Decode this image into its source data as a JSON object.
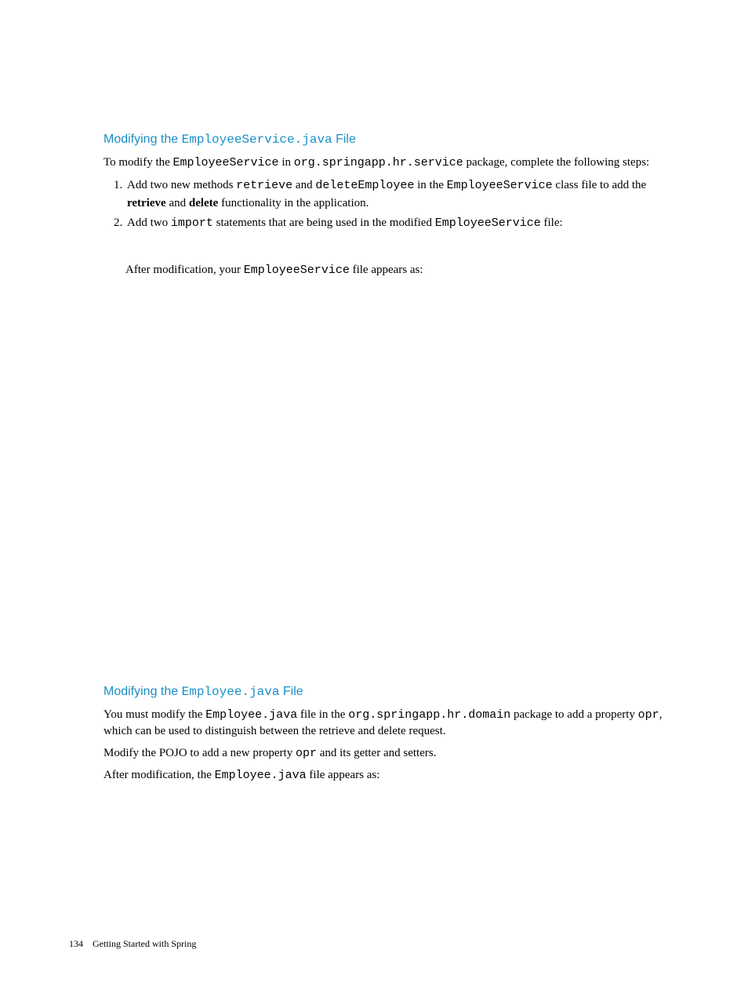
{
  "section1": {
    "heading_prefix": "Modifying the ",
    "heading_code": "EmployeeService.java",
    "heading_suffix": " File",
    "intro_p1": "To modify the ",
    "intro_code1": "EmployeeService",
    "intro_p2": " in ",
    "intro_code2": "org.springapp.hr.service",
    "intro_p3": " package, complete the following steps:",
    "step1_a": "Add two new methods ",
    "step1_code1": "retrieve",
    "step1_b": " and ",
    "step1_code2": "deleteEmployee",
    "step1_c": " in the ",
    "step1_code3": "EmployeeService",
    "step1_d": " class file to add the ",
    "step1_bold1": "retrieve",
    "step1_e": " and ",
    "step1_bold2": "delete",
    "step1_f": " functionality in the application.",
    "step2_a": "Add two ",
    "step2_code1": "import",
    "step2_b": " statements that are being used in the modified ",
    "step2_code2": "EmployeeService",
    "step2_c": " file:",
    "after_mod_a": "After modification, your ",
    "after_mod_code": "EmployeeService",
    "after_mod_b": " file appears as:"
  },
  "section2": {
    "heading_prefix": "Modifying the ",
    "heading_code": "Employee.java",
    "heading_suffix": " File",
    "p1_a": "You must modify the ",
    "p1_code1": "Employee.java",
    "p1_b": " file in the ",
    "p1_code2": "org.springapp.hr.domain",
    "p1_c": " package to add a property ",
    "p1_code3": "opr",
    "p1_d": ", which can be used to distinguish between the retrieve and delete request.",
    "p2_a": "Modify the POJO to add a new property ",
    "p2_code1": "opr",
    "p2_b": " and its getter and setters.",
    "p3_a": "After modification, the ",
    "p3_code1": "Employee.java",
    "p3_b": " file appears as:"
  },
  "footer": {
    "pagenum": "134",
    "title": "Getting Started with Spring"
  }
}
